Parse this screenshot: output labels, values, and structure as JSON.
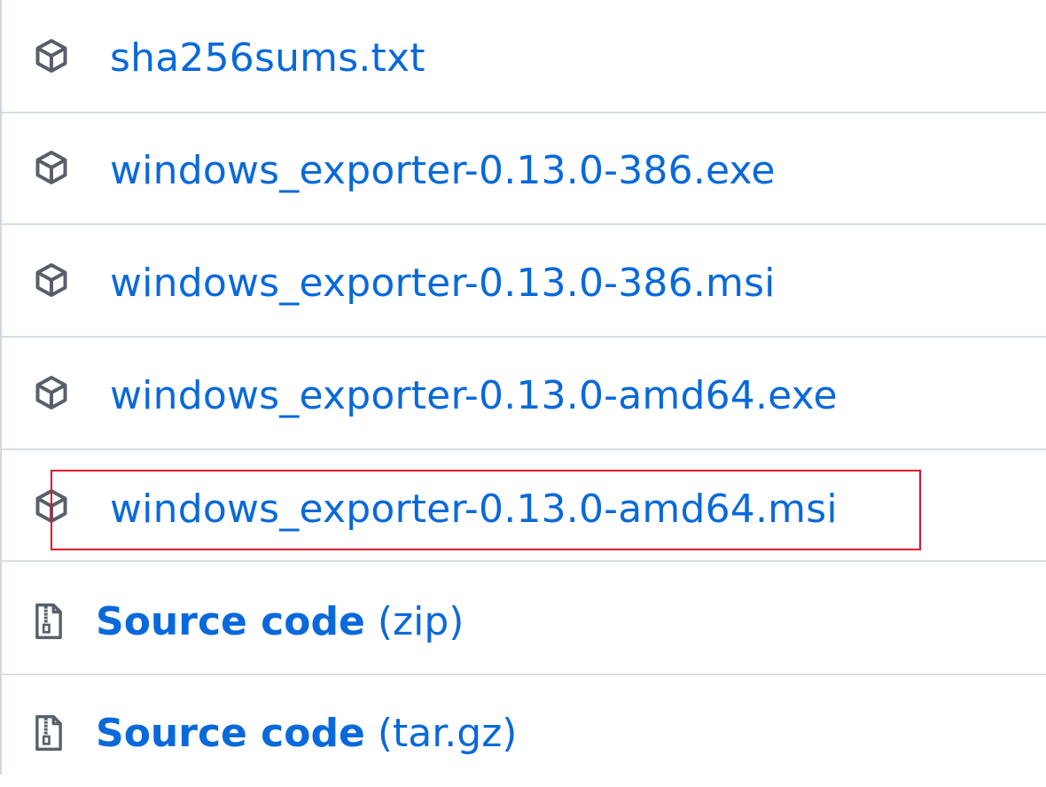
{
  "assets": [
    {
      "name": "sha256sums.txt",
      "icon": "package-icon"
    },
    {
      "name": "windows_exporter-0.13.0-386.exe",
      "icon": "package-icon"
    },
    {
      "name": "windows_exporter-0.13.0-386.msi",
      "icon": "package-icon"
    },
    {
      "name": "windows_exporter-0.13.0-amd64.exe",
      "icon": "package-icon"
    },
    {
      "name": "windows_exporter-0.13.0-amd64.msi",
      "icon": "package-icon"
    }
  ],
  "sources": [
    {
      "label": "Source code",
      "ext": "(zip)",
      "icon": "file-zip-icon"
    },
    {
      "label": "Source code",
      "ext": "(tar.gz)",
      "icon": "file-zip-icon"
    }
  ],
  "colors": {
    "link": "#0969da",
    "icon": "#57606a",
    "divider": "#d8dee4",
    "highlight": "#e0102c"
  }
}
